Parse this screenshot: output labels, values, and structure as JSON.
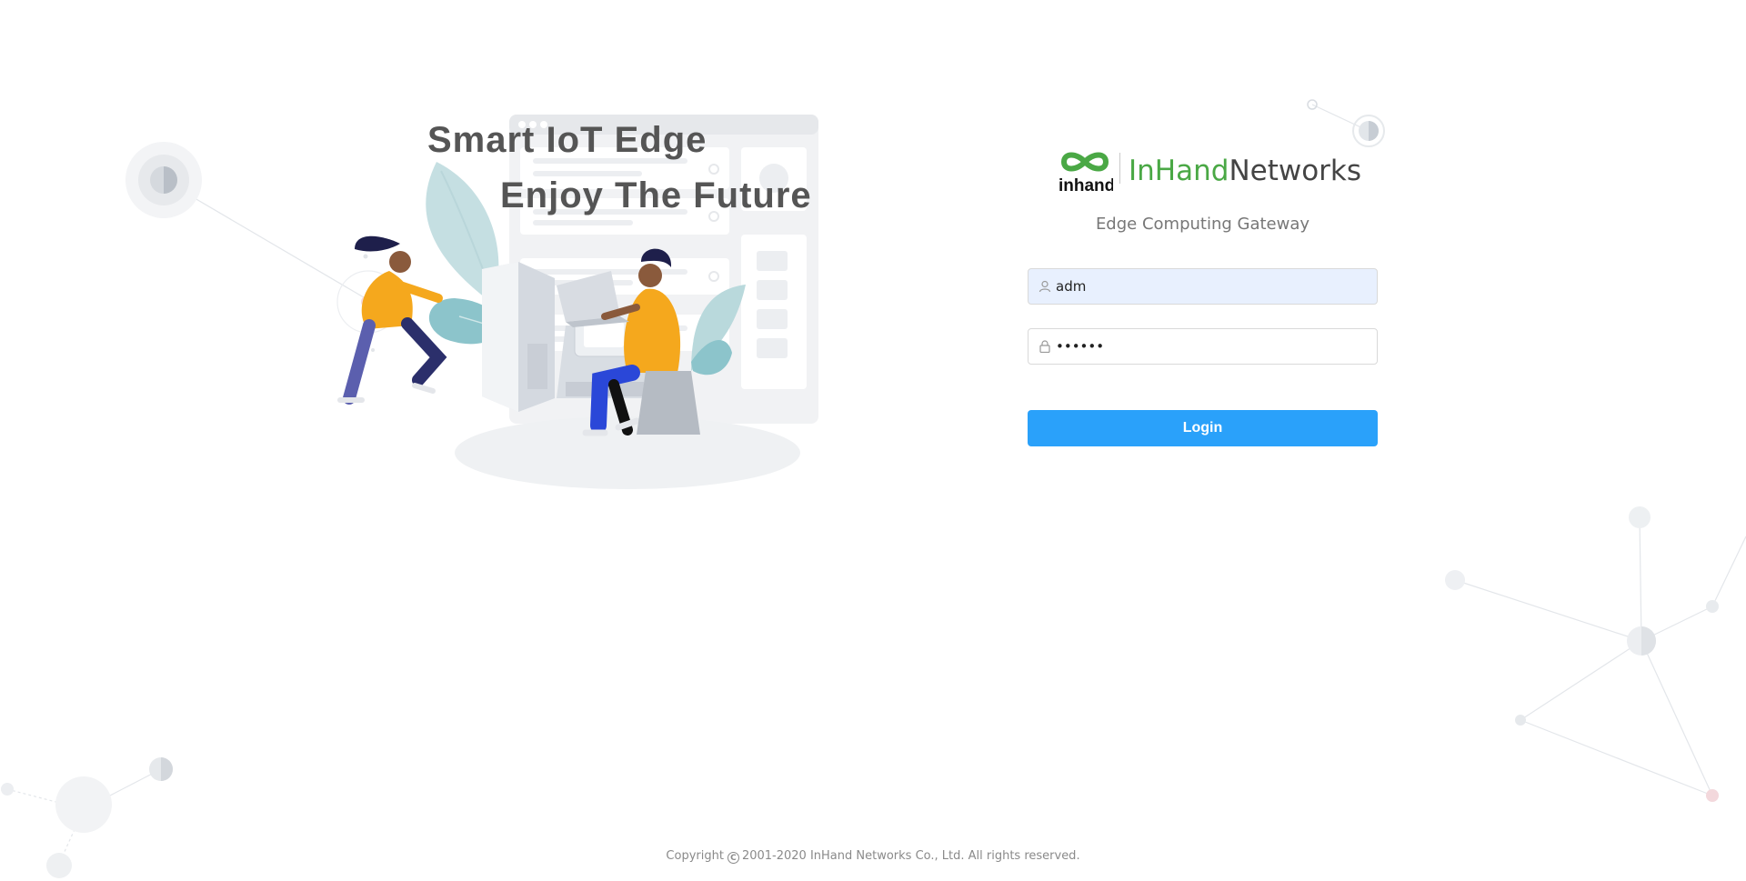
{
  "hero": {
    "headline_line1": "Smart IoT Edge",
    "headline_line2": "Enjoy The Future"
  },
  "brand": {
    "logo_text": "inhand",
    "name_part1": "InHand",
    "name_part2": "Networks",
    "subtitle": "Edge Computing Gateway",
    "colors": {
      "green": "#4aa845",
      "dark": "#444444"
    }
  },
  "login_form": {
    "username": {
      "icon": "user-icon",
      "value": "adm"
    },
    "password": {
      "icon": "lock-icon",
      "value": "••••••"
    },
    "submit_label": "Login",
    "accent_color": "#2aa1fa"
  },
  "footer": {
    "prefix": "Copyright",
    "copyright_symbol": "C",
    "text": "2001-2020 InHand Networks Co., Ltd. All rights reserved."
  }
}
